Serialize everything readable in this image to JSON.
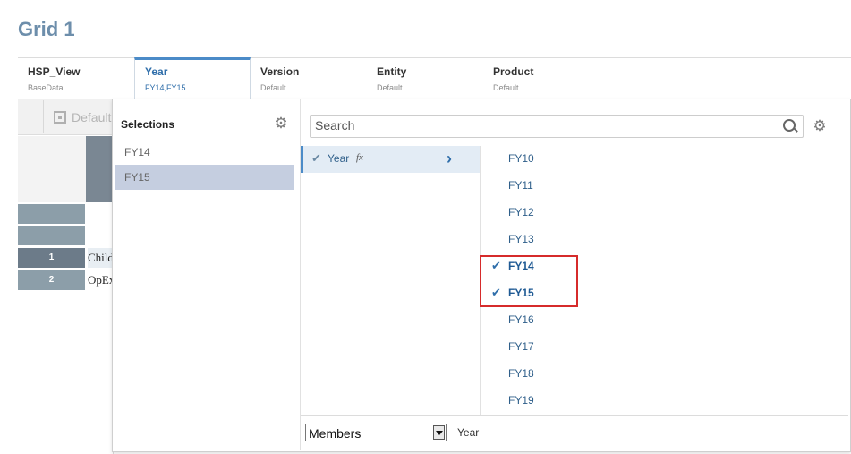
{
  "page_title": "Grid 1",
  "pov": [
    {
      "name": "HSP_View",
      "value": "BaseData"
    },
    {
      "name": "Year",
      "value": "FY14,FY15"
    },
    {
      "name": "Version",
      "value": "Default"
    },
    {
      "name": "Entity",
      "value": "Default"
    },
    {
      "name": "Product",
      "value": "Default"
    }
  ],
  "grid": {
    "toolbar_label": "Default",
    "rows": [
      {
        "num": "1",
        "text": "Child"
      },
      {
        "num": "2",
        "text": "OpEx"
      }
    ]
  },
  "selections": {
    "title": "Selections",
    "items": [
      "FY14",
      "FY15"
    ]
  },
  "search": {
    "placeholder": "Search"
  },
  "tree": {
    "label": "Year",
    "fx": "fx"
  },
  "members": {
    "items": [
      {
        "label": "FY10",
        "checked": false
      },
      {
        "label": "FY11",
        "checked": false
      },
      {
        "label": "FY12",
        "checked": false
      },
      {
        "label": "FY13",
        "checked": false
      },
      {
        "label": "FY14",
        "checked": true
      },
      {
        "label": "FY15",
        "checked": true
      },
      {
        "label": "FY16",
        "checked": false
      },
      {
        "label": "FY17",
        "checked": false
      },
      {
        "label": "FY18",
        "checked": false
      },
      {
        "label": "FY19",
        "checked": false
      }
    ]
  },
  "footer": {
    "select_value": "Members",
    "label": "Year"
  },
  "colors": {
    "accent": "#4b8bc8",
    "highlight": "#d62b2b",
    "selected_bg": "#c5cee0"
  }
}
